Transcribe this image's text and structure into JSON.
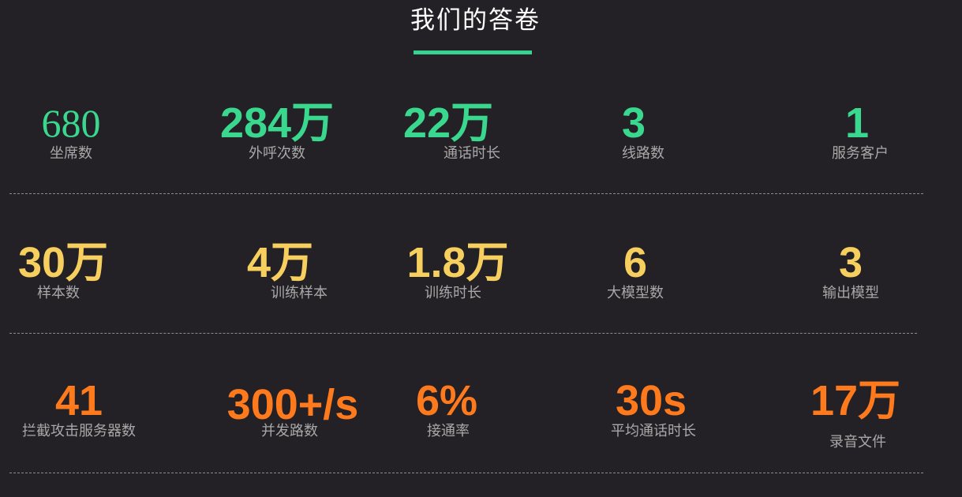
{
  "header": {
    "title": "我们的答卷",
    "accent_color": "#36d28f"
  },
  "colors": {
    "row1": "#3ad88f",
    "row2": "#f7cf5f",
    "row3": "#ff7a1c",
    "background": "#232125",
    "label": "#a8a8a8"
  },
  "rows": [
    [
      {
        "value": "680",
        "label": "坐席数"
      },
      {
        "value": "284万",
        "label": "外呼次数"
      },
      {
        "value": "22万",
        "label": "通话时长"
      },
      {
        "value": "3",
        "label": "线路数"
      },
      {
        "value": "1",
        "label": "服务客户"
      }
    ],
    [
      {
        "value": "30万",
        "label": "样本数"
      },
      {
        "value": "4万",
        "label": "训练样本"
      },
      {
        "value": "1.8万",
        "label": "训练时长"
      },
      {
        "value": "6",
        "label": "大模型数"
      },
      {
        "value": "3",
        "label": "输出模型"
      }
    ],
    [
      {
        "value": "41",
        "label": "拦截攻击服务器数"
      },
      {
        "value": "300+/s",
        "label": "并发路数"
      },
      {
        "value": "6%",
        "label": "接通率"
      },
      {
        "value": "30s",
        "label": "平均通话时长"
      },
      {
        "value": "17万",
        "label": "录音文件"
      }
    ]
  ]
}
